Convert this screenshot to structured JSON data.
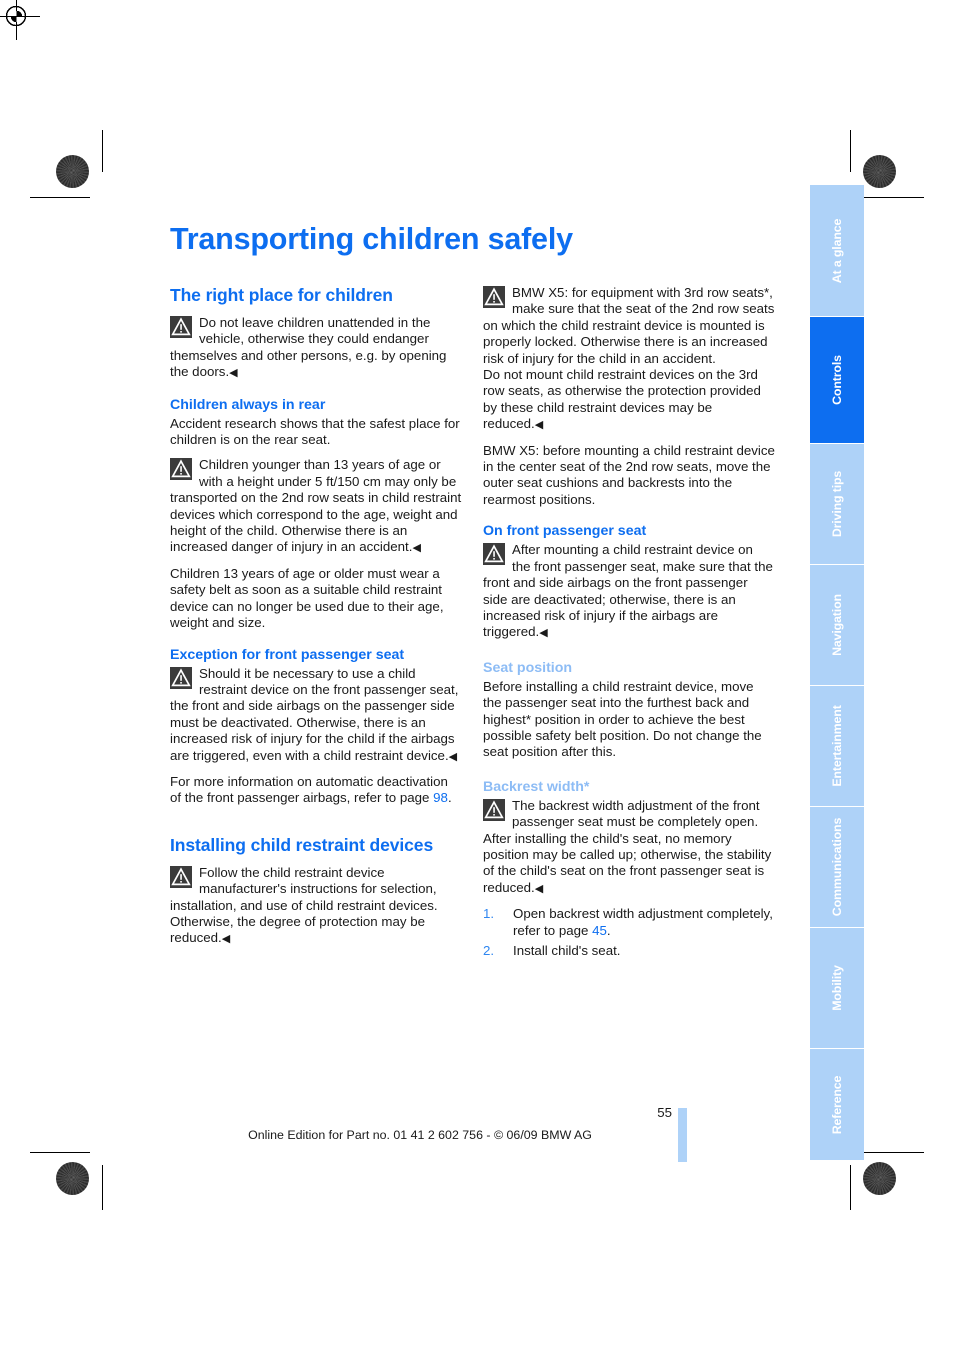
{
  "document": {
    "title": "Transporting children safely",
    "page_number": "55",
    "footer": "Online Edition for Part no. 01 41 2 602 756 - © 06/09 BMW AG"
  },
  "colors": {
    "heading_blue": "#0d6ef0",
    "subheading_light_blue": "#8dbcf5",
    "tab_inactive": "#aed2f8",
    "tab_active": "#0d6ef0",
    "link_blue": "#0d6ef0",
    "warning_icon_bg": "#3b3b3b",
    "body_text": "#1a1a1a"
  },
  "left_column": {
    "section_1": {
      "heading": "The right place for children",
      "warning_1": "Do not leave children unattended in the vehicle, otherwise they could endanger themselves and other persons, e.g. by opening the doors.",
      "sub_1": {
        "heading": "Children always in rear",
        "p1": "Accident research shows that the safest place for children is on the rear seat.",
        "warning": "Children younger than 13 years of age or with a height under 5 ft/150 cm may only be transported on the 2nd row seats in child restraint devices which correspond to the age, weight and height of the child. Otherwise there is an increased danger of injury in an accident.",
        "p2": "Children 13 years of age or older must wear a safety belt as soon as a suitable child restraint device can no longer be used due to their age, weight and size."
      },
      "sub_2": {
        "heading": "Exception for front passenger seat",
        "warning": "Should it be necessary to use a child restraint device on the front passenger seat, the front and side airbags on the passenger side must be deactivated. Otherwise, there is an increased risk of injury for the child if the airbags are triggered, even with a child restraint device.",
        "p1_before": "For more information on automatic deactivation of the front passenger airbags, refer to page ",
        "p1_link": "98",
        "p1_after": "."
      }
    },
    "section_2": {
      "heading": "Installing child restraint devices",
      "warning_1": "Follow the child restraint device manufacturer's instructions for selection, installation, and use of child restraint devices. Otherwise, the degree of protection may be reduced."
    }
  },
  "right_column": {
    "warning_1": "BMW X5: for equipment with 3rd row seats*, make sure that the seat of the 2nd row seats on which the child restraint device is mounted is properly locked. Otherwise there is an increased risk of injury for the child in an accident.",
    "warning_1_cont": "Do not mount child restraint devices on the 3rd row seats, as otherwise the protection provided by these child restraint devices may be reduced.",
    "p1": "BMW X5: before mounting a child restraint device in the center seat of the 2nd row seats, move the outer seat cushions and backrests into the rearmost positions.",
    "sub_1": {
      "heading": "On front passenger seat",
      "warning": "After mounting a child restraint device on the front passenger seat, make sure that the front and side airbags on the front passenger side are deactivated; otherwise, there is an increased risk of injury if the airbags are triggered."
    },
    "sub_2": {
      "heading": "Seat position",
      "p1": "Before installing a child restraint device, move the passenger seat into the furthest back and highest* position in order to achieve the best possible safety belt position. Do not change the seat position after this."
    },
    "sub_3": {
      "heading": "Backrest width*",
      "warning": "The backrest width adjustment of the front passenger seat must be completely open. After installing the child's seat, no memory position may be called up; otherwise, the stability of the child's seat on the front passenger seat is reduced.",
      "steps": [
        {
          "num": "1.",
          "text_before": "Open backrest width adjustment completely, refer to page ",
          "link": "45",
          "text_after": "."
        },
        {
          "num": "2.",
          "text_before": "Install child's seat.",
          "link": "",
          "text_after": ""
        }
      ]
    }
  },
  "sidebar": {
    "tabs": [
      {
        "label": "At a glance",
        "active": false
      },
      {
        "label": "Controls",
        "active": true
      },
      {
        "label": "Driving tips",
        "active": false
      },
      {
        "label": "Navigation",
        "active": false
      },
      {
        "label": "Entertainment",
        "active": false
      },
      {
        "label": "Communications",
        "active": false
      },
      {
        "label": "Mobility",
        "active": false
      },
      {
        "label": "Reference",
        "active": false
      }
    ]
  },
  "print_marks": {
    "warning_icon_name": "warning-triangle-icon",
    "registration_mark_name": "registration-mark",
    "halftone_name": "halftone-density-patch"
  }
}
